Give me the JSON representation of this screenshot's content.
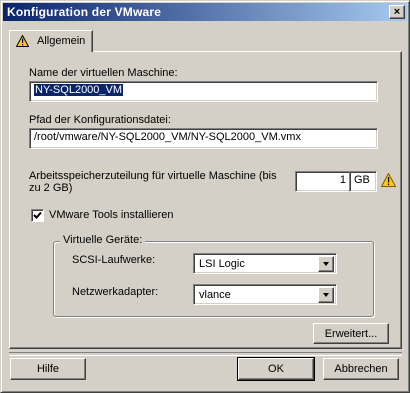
{
  "window": {
    "title": "Konfiguration der VMware",
    "close_label": "×"
  },
  "tabs": [
    {
      "label": "Allgemein",
      "icon": "warning-icon"
    }
  ],
  "form": {
    "vm_name_label": "Name der virtuellen Maschine:",
    "vm_name_value": "NY-SQL2000_VM",
    "config_path_label": "Pfad der Konfigurationsdatei:",
    "config_path_value": "/root/vmware/NY-SQL2000_VM/NY-SQL2000_VM.vmx",
    "memory_label_line1": "Arbeitsspeicherzuteilung für virtuelle Maschine (bis",
    "memory_label_line2": "zu 2 GB)",
    "memory_value": "1",
    "memory_unit": "GB",
    "memory_warning_icon": "warning-icon",
    "tools_checkbox_label": "VMware Tools installieren",
    "tools_checkbox_checked": true
  },
  "virtual_devices": {
    "title": "Virtuelle Geräte:",
    "scsi_label": "SCSI-Laufwerke:",
    "scsi_value": "LSI Logic",
    "network_label": "Netzwerkadapter:",
    "network_value": "vlance"
  },
  "buttons": {
    "advanced": "Erweitert...",
    "help": "Hilfe",
    "ok": "OK",
    "cancel": "Abbrechen"
  },
  "colors": {
    "title_start": "#0a246a",
    "title_end": "#a6caf0",
    "face": "#d4d0c8",
    "selection": "#0a246a",
    "warning": "#ffcc00"
  }
}
